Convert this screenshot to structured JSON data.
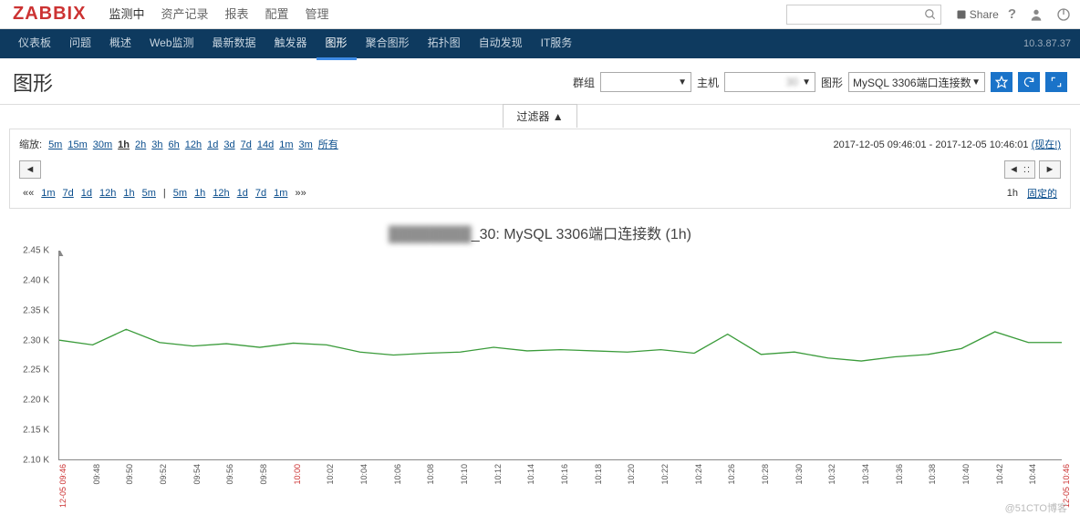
{
  "header": {
    "logo": "ZABBIX",
    "nav": [
      "监测中",
      "资产记录",
      "报表",
      "配置",
      "管理"
    ],
    "active_nav": 0,
    "share": "Share",
    "ip": "10.3.87.37"
  },
  "subnav": {
    "items": [
      "仪表板",
      "问题",
      "概述",
      "Web监测",
      "最新数据",
      "触发器",
      "图形",
      "聚合图形",
      "拓扑图",
      "自动发现",
      "IT服务"
    ],
    "active": 6
  },
  "title": "图形",
  "controls": {
    "group_label": "群组",
    "group_value": "",
    "host_label": "主机",
    "host_value": "30",
    "graph_label": "图形",
    "graph_value": "MySQL 3306端口连接数"
  },
  "filter_tab": "过滤器  ▲",
  "zoom": {
    "label": "缩放:",
    "items": [
      "5m",
      "15m",
      "30m",
      "1h",
      "2h",
      "3h",
      "6h",
      "12h",
      "1d",
      "3d",
      "7d",
      "14d",
      "1m",
      "3m",
      "所有"
    ],
    "active": 3,
    "range_from": "2017-12-05 09:46:01",
    "range_to": "2017-12-05 10:46:01",
    "now": "(现在!)",
    "row2_left": [
      "1m",
      "7d",
      "1d",
      "12h",
      "1h",
      "5m"
    ],
    "row2_right": [
      "5m",
      "1h",
      "12h",
      "1d",
      "7d",
      "1m"
    ],
    "fixed_label": "1h",
    "fixed_text": "固定的"
  },
  "chart_data": {
    "type": "line",
    "title_prefix": "_30: ",
    "title": "MySQL 3306端口连接数 (1h)",
    "ylabel": "",
    "ylim": [
      2100,
      2450
    ],
    "yticks": [
      2100,
      2150,
      2200,
      2250,
      2300,
      2350,
      2400,
      2450
    ],
    "ytick_labels": [
      "2.10 K",
      "2.15 K",
      "2.20 K",
      "2.25 K",
      "2.30 K",
      "2.35 K",
      "2.40 K",
      "2.45 K"
    ],
    "x": [
      "12-05 09:46",
      "09:48",
      "09:50",
      "09:52",
      "09:54",
      "09:56",
      "09:58",
      "10:00",
      "10:02",
      "10:04",
      "10:06",
      "10:08",
      "10:10",
      "10:12",
      "10:14",
      "10:16",
      "10:18",
      "10:20",
      "10:22",
      "10:24",
      "10:26",
      "10:28",
      "10:30",
      "10:32",
      "10:34",
      "10:36",
      "10:38",
      "10:40",
      "10:42",
      "10:44",
      "12-05 10:46"
    ],
    "values": [
      2300,
      2292,
      2318,
      2296,
      2290,
      2294,
      2288,
      2295,
      2292,
      2280,
      2275,
      2278,
      2280,
      2288,
      2282,
      2284,
      2282,
      2280,
      2284,
      2278,
      2310,
      2276,
      2280,
      2270,
      2265,
      2272,
      2276,
      2286,
      2314,
      2296,
      2296
    ],
    "x_red_indices": [
      0,
      7,
      30
    ],
    "color": "#3a9b3a"
  },
  "watermark": "@51CTO博客"
}
